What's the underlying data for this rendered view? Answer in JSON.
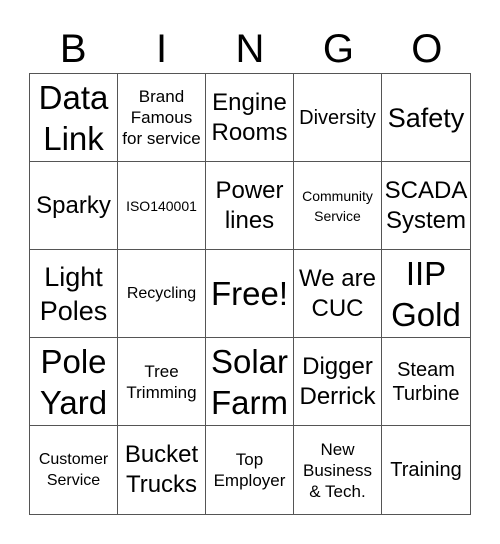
{
  "header": {
    "letters": [
      "B",
      "I",
      "N",
      "G",
      "O"
    ]
  },
  "board": {
    "cells": [
      {
        "text": "Data\nLink",
        "size": "xl"
      },
      {
        "text": "Brand\nFamous\nfor service",
        "size": "s"
      },
      {
        "text": "Engine\nRooms",
        "size": "m"
      },
      {
        "text": "Diversity",
        "size": "sm"
      },
      {
        "text": "Safety",
        "size": "l"
      },
      {
        "text": "Sparky",
        "size": "m"
      },
      {
        "text": "ISO140001",
        "size": "xxs"
      },
      {
        "text": "Power\nlines",
        "size": "m"
      },
      {
        "text": "Community\nService",
        "size": "xxs"
      },
      {
        "text": "SCADA\nSystem",
        "size": "m"
      },
      {
        "text": "Light\nPoles",
        "size": "l"
      },
      {
        "text": "Recycling",
        "size": "xs"
      },
      {
        "text": "Free!",
        "size": "xl"
      },
      {
        "text": "We are\nCUC",
        "size": "m"
      },
      {
        "text": "IIP\nGold",
        "size": "xl"
      },
      {
        "text": "Pole\nYard",
        "size": "xl"
      },
      {
        "text": "Tree\nTrimming",
        "size": "s"
      },
      {
        "text": "Solar\nFarm",
        "size": "xl"
      },
      {
        "text": "Digger\nDerrick",
        "size": "m"
      },
      {
        "text": "Steam\nTurbine",
        "size": "sm"
      },
      {
        "text": "Customer\nService",
        "size": "xs"
      },
      {
        "text": "Bucket\nTrucks",
        "size": "m"
      },
      {
        "text": "Top\nEmployer",
        "size": "s"
      },
      {
        "text": "New\nBusiness\n& Tech.",
        "size": "s"
      },
      {
        "text": "Training",
        "size": "sm"
      }
    ]
  }
}
